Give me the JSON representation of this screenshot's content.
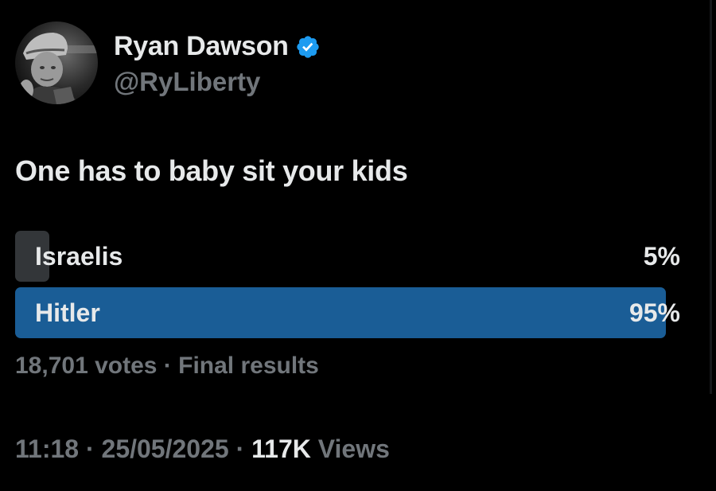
{
  "author": {
    "display_name": "Ryan Dawson",
    "handle": "@RyLiberty",
    "verified_color": "#1d9bf0",
    "avatar_icon": "avatar"
  },
  "tweet": {
    "text": "One has to baby sit your kids"
  },
  "poll": {
    "options": [
      {
        "label": "Israelis",
        "percent": "5%",
        "fraction": 0.05,
        "bar_color": "#333639"
      },
      {
        "label": "Hitler",
        "percent": "95%",
        "fraction": 0.95,
        "bar_color": "#1a5d96"
      }
    ],
    "votes": "18,701 votes",
    "separator": " · ",
    "status": "Final results"
  },
  "meta": {
    "time": "11:18",
    "date": "25/05/2025",
    "separator": " · ",
    "views_count": "117K",
    "views_label": "Views"
  },
  "colors": {
    "background": "#000000",
    "primary_text": "#e7e9ea",
    "secondary_text": "#71767b"
  }
}
